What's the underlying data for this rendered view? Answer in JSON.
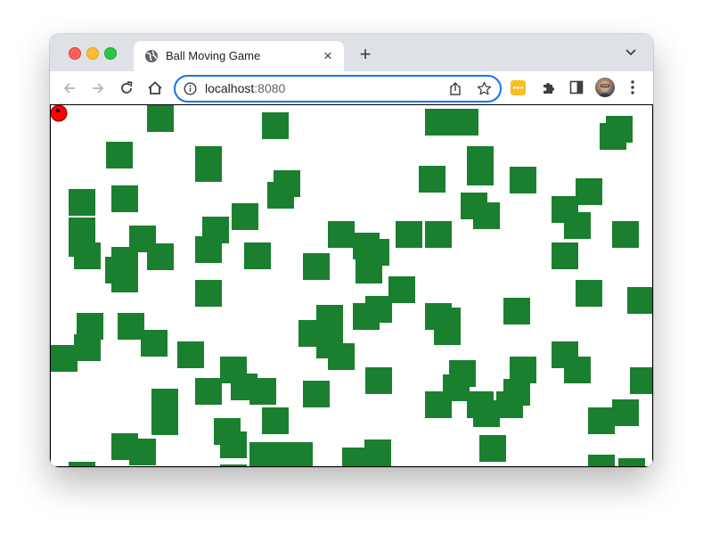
{
  "browser": {
    "tab_title": "Ball Moving Game",
    "tab_close_glyph": "×",
    "new_tab_glyph": "+",
    "url_host": "localhost",
    "url_port": ":8080",
    "icons": [
      "globe-icon",
      "close-icon",
      "plus-icon",
      "tab-search-icon",
      "back-icon",
      "forward-icon",
      "reload-icon",
      "home-icon",
      "info-icon",
      "share-icon",
      "star-icon",
      "extension-icon",
      "puzzle-icon",
      "side-panel-icon",
      "avatar",
      "more-icon"
    ]
  },
  "game": {
    "ball_color": "#ff0000",
    "block_color": "#1a7f2e"
  }
}
